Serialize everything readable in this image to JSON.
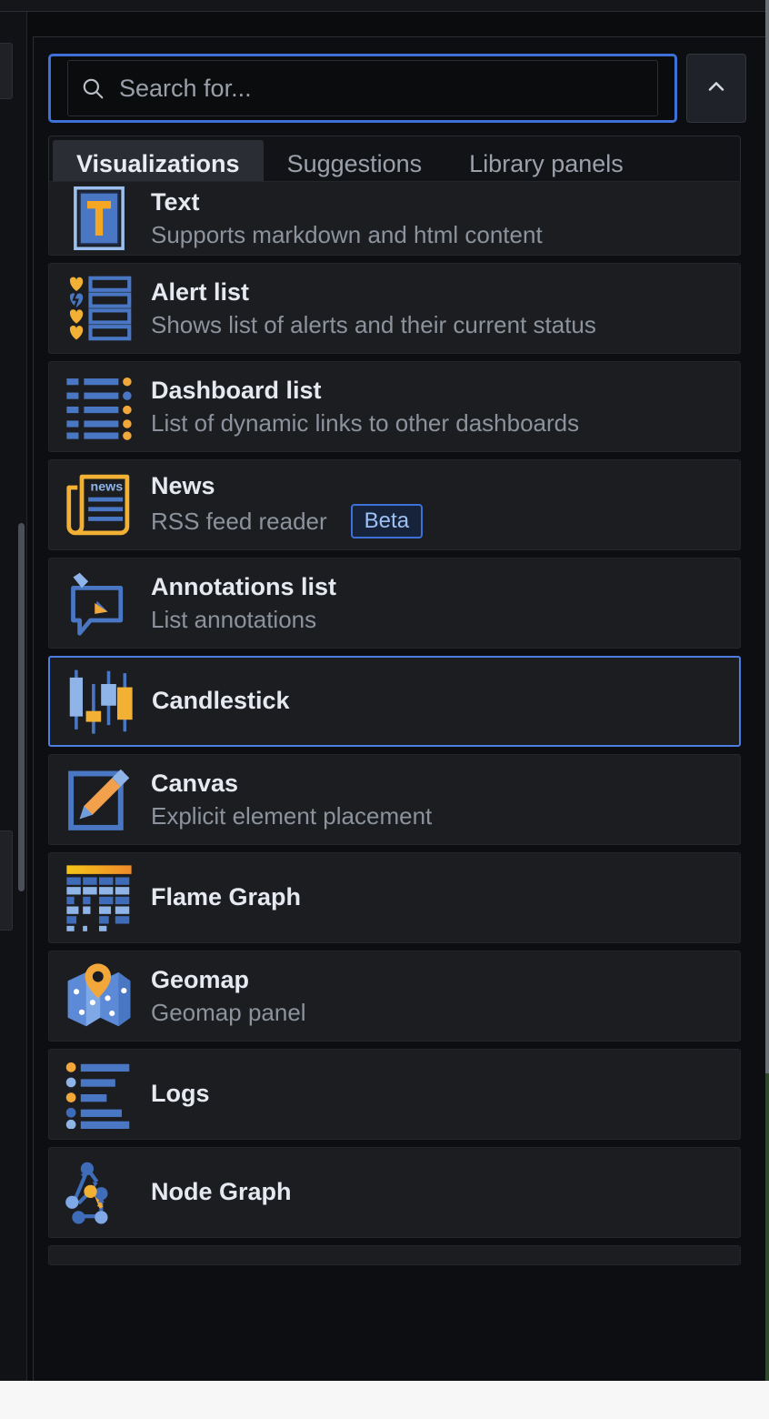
{
  "search": {
    "placeholder": "Search for...",
    "value": "",
    "icon": "search-icon"
  },
  "collapse_button": {
    "icon": "chevron-up-icon",
    "label": ""
  },
  "tabs": [
    {
      "label": "Visualizations",
      "active": true
    },
    {
      "label": "Suggestions",
      "active": false
    },
    {
      "label": "Library panels",
      "active": false
    }
  ],
  "colors": {
    "accent_blue": "#3d71d9",
    "selected_border": "#4b7ee0",
    "icon_blue": "#4a77c4",
    "icon_light_blue": "#8fb4e8",
    "icon_orange": "#f2a73b",
    "icon_yellow": "#f5c518",
    "card_bg": "#1b1d21",
    "panel_bg": "#0d0e11",
    "title_text": "#e6eaf0",
    "desc_text": "#8d939d"
  },
  "visualizations": [
    {
      "name": "Text",
      "description": "Supports markdown and html content",
      "icon": "text-panel-icon",
      "badge": null,
      "selected": false,
      "clipped": "top"
    },
    {
      "name": "Alert list",
      "description": "Shows list of alerts and their current status",
      "icon": "alert-list-icon",
      "badge": null,
      "selected": false
    },
    {
      "name": "Dashboard list",
      "description": "List of dynamic links to other dashboards",
      "icon": "dashboard-list-icon",
      "badge": null,
      "selected": false
    },
    {
      "name": "News",
      "description": "RSS feed reader",
      "icon": "news-icon",
      "badge": "Beta",
      "selected": false
    },
    {
      "name": "Annotations list",
      "description": "List annotations",
      "icon": "annotations-list-icon",
      "badge": null,
      "selected": false
    },
    {
      "name": "Candlestick",
      "description": "",
      "icon": "candlestick-icon",
      "badge": null,
      "selected": true
    },
    {
      "name": "Canvas",
      "description": "Explicit element placement",
      "icon": "canvas-icon",
      "badge": null,
      "selected": false
    },
    {
      "name": "Flame Graph",
      "description": "",
      "icon": "flame-graph-icon",
      "badge": null,
      "selected": false
    },
    {
      "name": "Geomap",
      "description": "Geomap panel",
      "icon": "geomap-icon",
      "badge": null,
      "selected": false
    },
    {
      "name": "Logs",
      "description": "",
      "icon": "logs-icon",
      "badge": null,
      "selected": false
    },
    {
      "name": "Node Graph",
      "description": "",
      "icon": "node-graph-icon",
      "badge": null,
      "selected": false
    }
  ]
}
